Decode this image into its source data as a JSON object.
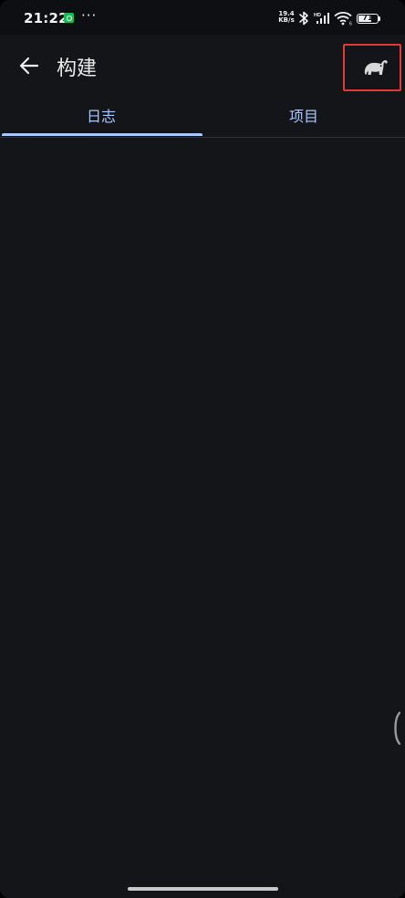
{
  "status_bar": {
    "time": "21:22",
    "app_icon": "green-app-icon",
    "more": "···",
    "net_speed_value": "19.4",
    "net_speed_unit": "KB/s",
    "battery": "71",
    "battery_level": 0.71
  },
  "toolbar": {
    "back_icon": "arrow-left-icon",
    "title": "构建",
    "action_icon": "gradle-elephant-icon"
  },
  "tabs": [
    {
      "label": "日志",
      "selected": true
    },
    {
      "label": "项目",
      "selected": false
    }
  ],
  "colors": {
    "background": "#141519",
    "accent": "#a9c7ff",
    "highlight_border": "#e53935"
  }
}
